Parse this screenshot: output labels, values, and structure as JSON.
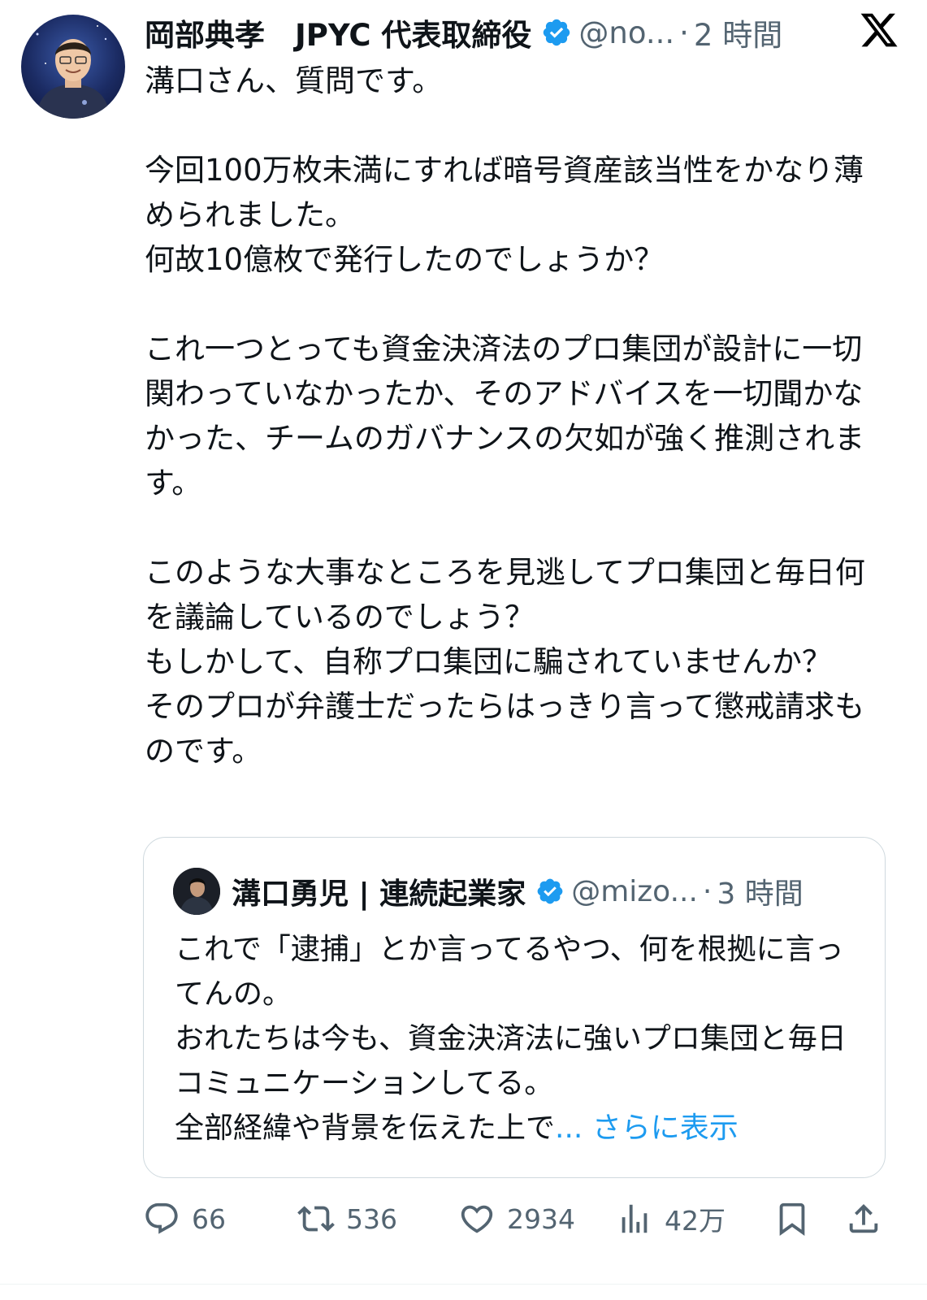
{
  "tweet": {
    "author_name": "岡部典孝　JPYC 代表取締役",
    "handle": "@no...",
    "time_sep": "·",
    "time": "2 時間",
    "paragraphs": [
      [
        "溝口さん、質問です。"
      ],
      [
        "今回100万枚未満にすれば暗号資産該当性をかなり薄められました。",
        "何故10億枚で発行したのでしょうか？"
      ],
      [
        "これ一つとっても資金決済法のプロ集団が設計に一切関わっていなかったか、そのアドバイスを一切聞かなかった、チームのガバナンスの欠如が強く推測されます。"
      ],
      [
        "このような大事なところを見逃してプロ集団と毎日何を議論しているのでしょう？",
        "もしかして、自称プロ集団に騙されていませんか？",
        "そのプロが弁護士だったらはっきり言って懲戒請求ものです。"
      ]
    ]
  },
  "quote": {
    "author_name": "溝口勇児 | 連続起業家",
    "handle": "@mizo...",
    "time_sep": "·",
    "time": "3 時間",
    "lines": [
      "これで「逮捕」とか言ってるやつ、何を根拠に言ってんの。",
      "おれたちは今も、資金決済法に強いプロ集団と毎日コミュニケーションしてる。"
    ],
    "last_line": "全部経緯や背景を伝えた上で",
    "show_more": "... さらに表示"
  },
  "actions": {
    "replies": "66",
    "retweets": "536",
    "likes": "2934",
    "views": "42万"
  },
  "icons": [
    "verified-badge-icon",
    "x-logo-icon",
    "reply-icon",
    "retweet-icon",
    "like-icon",
    "views-icon",
    "bookmark-icon",
    "share-icon"
  ],
  "colors": {
    "verified": "#1d9bf0",
    "muted": "#536471",
    "link": "#1d9bf0"
  }
}
